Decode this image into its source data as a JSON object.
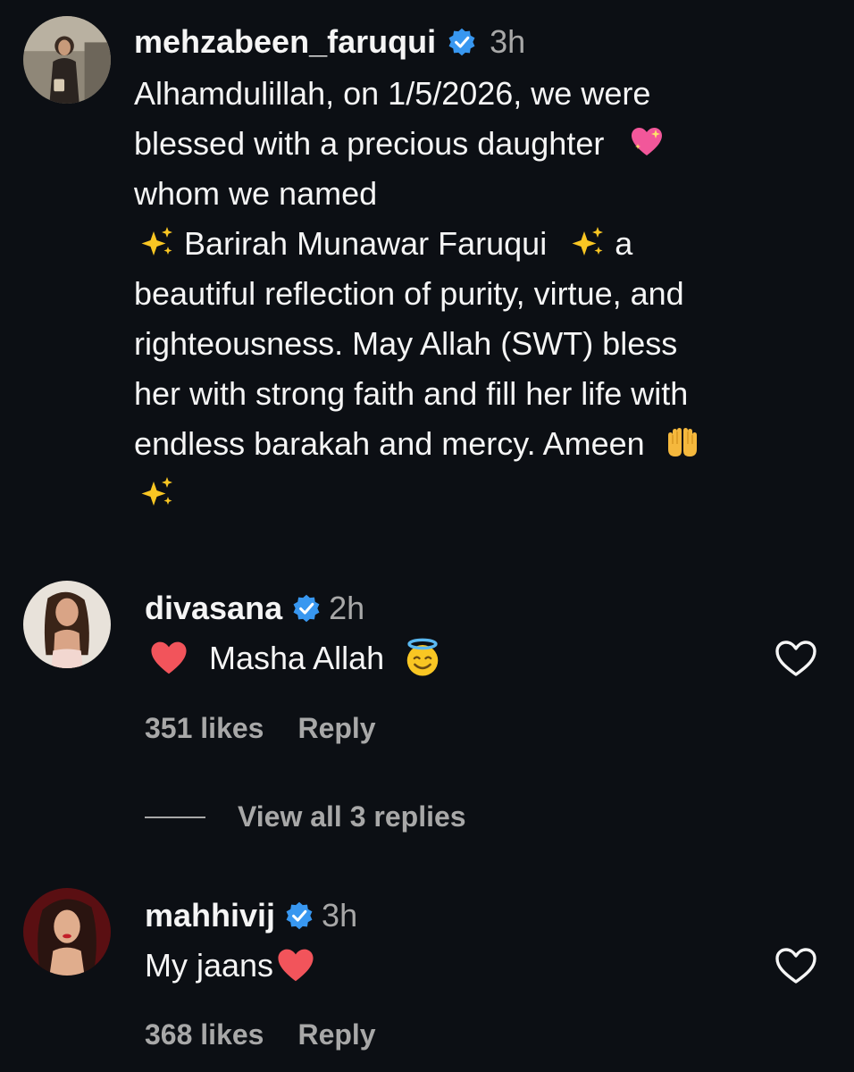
{
  "post": {
    "username": "mehzabeen_faruqui",
    "verified_icon": "verified-badge-icon",
    "time": "3h",
    "caption_lines": [
      "Alhamdulillah, on 1/5/2026, we were",
      "blessed with a precious daughter",
      "whom we named",
      "Barirah Munawar Faruqui",
      "a",
      "beautiful reflection of purity, virtue, and",
      "righteousness. May Allah (SWT) bless",
      "her with strong faith and fill her life with",
      "endless barakah and mercy. Ameen"
    ],
    "emojis": [
      "sparkling-heart-emoji",
      "sparkles-emoji",
      "palms-up-emoji"
    ]
  },
  "comments": [
    {
      "username": "divasana",
      "time": "2h",
      "text": "Masha Allah",
      "likes": "351 likes",
      "reply": "Reply",
      "view_replies": "View all 3 replies",
      "emojis": [
        "red-heart-emoji",
        "smiling-face-with-halo-emoji"
      ]
    },
    {
      "username": "mahhivij",
      "time": "3h",
      "text": "My jaans",
      "likes": "368 likes",
      "reply": "Reply",
      "emojis": [
        "red-heart-emoji"
      ]
    }
  ],
  "colors": {
    "background": "#0c0f14",
    "text": "#f5f5f5",
    "secondary": "#a8a8a8",
    "verified": "#3897f0"
  }
}
